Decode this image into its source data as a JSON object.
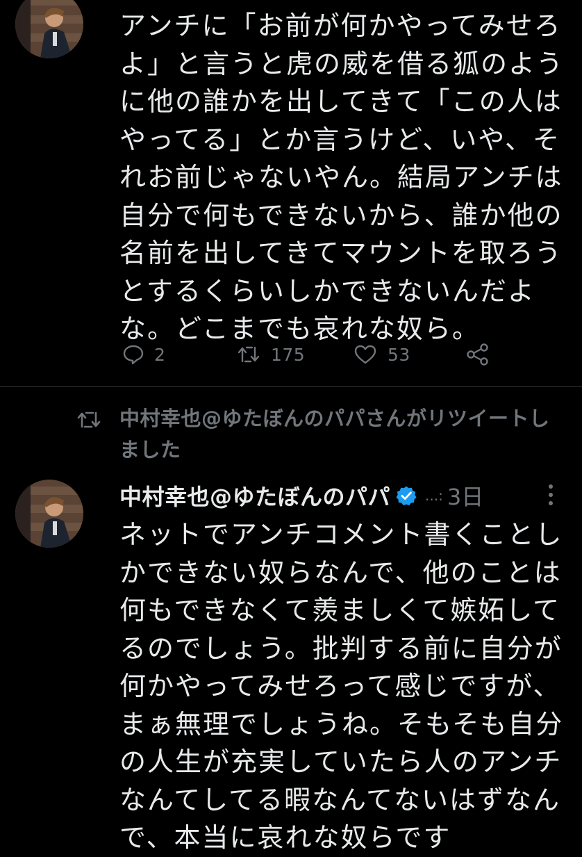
{
  "first_tweet": {
    "text": "アンチに「お前が何かやってみせろよ」と言うと虎の威を借る狐のように他の誰かを出してきて「この人はやってる」とか言うけど、いや、それお前じゃないやん。結局アンチは自分で何もできないから、誰か他の名前を出してきてマウントを取ろうとするくらいしかできないんだよな。どこまでも哀れな奴ら。",
    "actions": {
      "reply_icon": "reply-bubble-icon",
      "reply_count": "2",
      "retweet_icon": "retweet-icon",
      "retweet_count": "175",
      "like_icon": "heart-icon",
      "like_count": "53",
      "share_icon": "share-icon"
    }
  },
  "retweet_notice": {
    "icon": "retweet-icon",
    "text": "中村幸也@ゆたぼんのパパさんがリツイートしました"
  },
  "second_tweet": {
    "display_name": "中村幸也@ゆたぼんのパパ",
    "verified_icon": "verified-badge-icon",
    "handle": "...:",
    "time": "3日",
    "more_icon": "more-vertical-icon",
    "text": "ネットでアンチコメント書くことしかできない奴らなんで、他のことは何もできなくて羨ましくて嫉妬してるのでしょう。批判する前に自分が何かやってみせろって感じですが、まぁ無理でしょうね。そもそも自分の人生が充実していたら人のアンチなんてしてる暇なんてないはずなんで、本当に哀れな奴らです"
  },
  "colors": {
    "background": "#000000",
    "text": "#e7e9ea",
    "muted": "#71767b",
    "verified": "#1d9bf0",
    "divider": "#2f3336"
  }
}
